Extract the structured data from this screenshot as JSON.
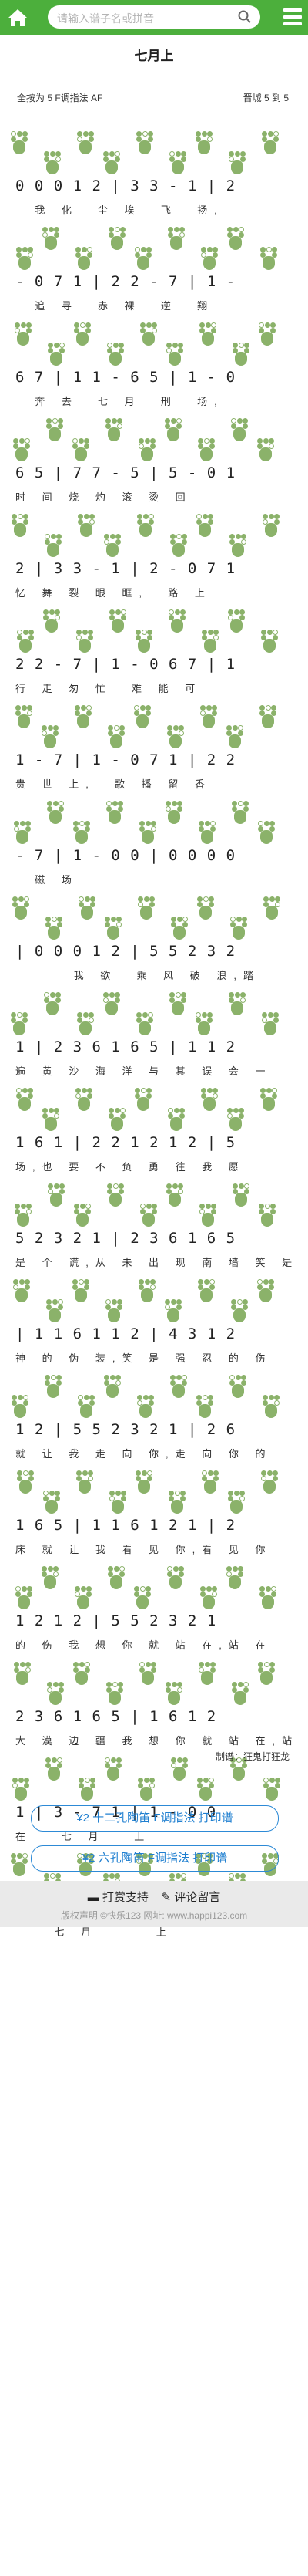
{
  "search": {
    "placeholder": "请输入谱子名或拼音"
  },
  "song": {
    "title": "七月上"
  },
  "meta": {
    "fingering": "全按为 5 F调指法 AF",
    "singer": "晋城 5 到 5"
  },
  "rows": [
    {
      "notes": "0 0 0 1 2 | 3 3 - 1 | 2",
      "lyrics": "  我 化  尘 埃  飞  扬,"
    },
    {
      "notes": "- 0 7 1 | 2 2 - 7 | 1 -",
      "lyrics": "  追 寻  赤 裸  逆  翔"
    },
    {
      "notes": "6 7 | 1 1 - 6 5 | 1 - 0",
      "lyrics": "  奔 去  七 月  刑  场,"
    },
    {
      "notes": "6 5 | 7 7 - 5 | 5 - 0 1",
      "lyrics": "时 间 烧 灼 滚 烫 回"
    },
    {
      "notes": "2 | 3 3 - 1 | 2 - 0 7 1",
      "lyrics": "忆 舞 裂 眼 眶,  路 上"
    },
    {
      "notes": "2 2 - 7 | 1 - 0 6 7 | 1",
      "lyrics": "行 走 匆 忙  难 能 可"
    },
    {
      "notes": "1 - 7 | 1 - 0 7 1 | 2 2",
      "lyrics": "贵 世 上,  歌 播 留 香"
    },
    {
      "notes": "- 7 | 1 - 0 0 | 0 0 0 0",
      "lyrics": "  磁 场"
    },
    {
      "notes": "| 0 0 0 1 2 | 5 5 2 3 2",
      "lyrics": "      我 欲  乘 风 破 浪,踏"
    },
    {
      "notes": "1 | 2 3 6 1 6 5 | 1 1 2",
      "lyrics": "遍 黄 沙 海 洋 与 其 误 会 一"
    },
    {
      "notes": "1 6 1 | 2 2 1 2 1 2 | 5",
      "lyrics": "场,也 要 不 负 勇 往 我 愿"
    },
    {
      "notes": "5 2 3 2 1 | 2 3 6 1 6 5",
      "lyrics": "是 个 谎,从 未 出 现 南 墙 笑 是"
    },
    {
      "notes": "| 1 1 6 1 1 2 | 4 3 1 2",
      "lyrics": "神 的 伪 装,笑 是 强 忍 的 伤"
    },
    {
      "notes": "1 2 | 5 5 2 3 2 1 | 2 6",
      "lyrics": "就 让 我 走 向 你,走 向 你 的"
    },
    {
      "notes": "1 6 5 | 1 1 6 1 2 1 | 2",
      "lyrics": "床 就 让 我 看 见 你,看 见 你"
    },
    {
      "notes": "1 2 1 2 | 5 5 2 3 2 1",
      "lyrics": "的 伤 我 想 你 就 站 在,站 在"
    },
    {
      "notes": "2 3 6 1 6 5 | 1 6 1 2",
      "lyrics": "大 漠 边 疆 我 想 你 就 站 在,站"
    },
    {
      "notes": "1 | 3 - 7 1 | 1 - 0 0",
      "lyrics": "在   七 月   上"
    },
    {
      "notes": ":| 3 - 7 - | 1 - - - ||",
      "lyrics": "    七 月      上"
    }
  ],
  "credit": "制谱：狂鬼打狂龙",
  "buttons": {
    "twelve": "¥2 十二孔陶笛 F调指法 打印谱",
    "six": "¥2 六孔陶笛 F调指法 打印谱"
  },
  "footer": {
    "tip": "打赏支持",
    "comment": "评论留言",
    "copyright": "版权声明 ©快乐123 网址: www.happi123.com"
  }
}
